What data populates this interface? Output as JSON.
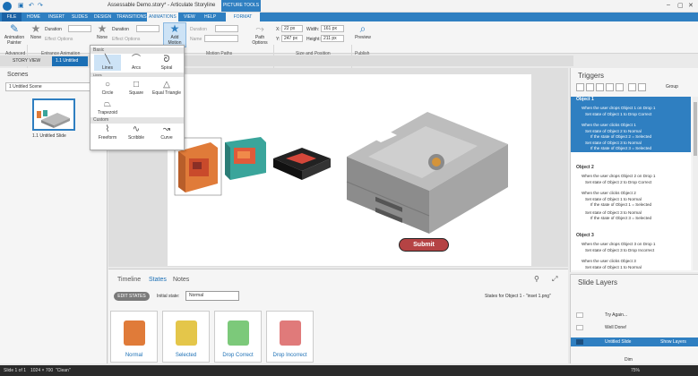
{
  "window": {
    "title": "Assessable Demo.story* - Articulate Storyline",
    "picture_tools": "PICTURE TOOLS"
  },
  "tabs": [
    "FILE",
    "HOME",
    "INSERT",
    "SLIDES",
    "DESIGN",
    "TRANSITIONS",
    "ANIMATIONS",
    "VIEW",
    "HELP",
    "FORMAT"
  ],
  "ribbon": {
    "animation_painter": "Animation Painter",
    "advanced": "Advanced",
    "entrance_none": "None",
    "duration_label": "Duration",
    "effect_options": "Effect Options",
    "entrance_group": "Entrance Animation",
    "exit_none": "None",
    "exit_group": "Exit Animation",
    "add_motion_path": "Add Motion Path",
    "duration2": "Duration",
    "name_label": "Name",
    "path_options": "Path Options",
    "motion_group": "Motion Paths",
    "x_label": "X:",
    "x_value": "22 px",
    "y_label": "Y:",
    "y_value": "247 px",
    "width_label": "Width:",
    "width_value": "161 px",
    "height_label": "Height:",
    "height_value": "211 px",
    "size_group": "Size and Position",
    "preview": "Preview",
    "publish": "Publish"
  },
  "view_tabs": {
    "story_view": "STORY VIEW",
    "slide_tab": "1.1 Untitled Sli..."
  },
  "scenes": {
    "title": "Scenes",
    "selected": "1 Untitled Scene",
    "thumb_label": "1.1 Untitled Slide"
  },
  "shapes": {
    "basic": "Basic",
    "lines_tooltip": "Lines",
    "custom": "Custom",
    "items": [
      "Lines",
      "Arcs",
      "Spiral",
      "Circle",
      "Square",
      "Equal Triangle",
      "Trapezoid",
      "Freeform",
      "Scribble",
      "Curve"
    ]
  },
  "submit": "Submit",
  "bottom": {
    "tabs": [
      "Timeline",
      "States",
      "Notes"
    ],
    "edit_states": "EDIT STATES",
    "initial_state_label": "Initial state:",
    "initial_state": "Normal",
    "states_for": "States for Object 1 - \"inset 1.png\"",
    "states": [
      "Normal",
      "Selected",
      "Drop Correct",
      "Drop Incorrect"
    ]
  },
  "triggers": {
    "title": "Triggers",
    "group": "Group",
    "objects": [
      {
        "name": "Object 1",
        "lines": [
          "When the user drops Object 1 on Drop 1",
          "Set state of Object 1 to Drop Correct",
          "When the user clicks Object 1",
          "Set state of Object 2 to Normal",
          "If the state of Object 2 = Selected",
          "Set state of Object 3 to Normal",
          "If the state of Object 3 = Selected"
        ]
      },
      {
        "name": "Object 2",
        "lines": [
          "When the user drops Object 2 on Drop 1",
          "Set state of Object 2 to Drop Correct",
          "When the user clicks Object 2",
          "Set state of Object 1 to Normal",
          "If the state of Object 1 = Selected",
          "Set state of Object 3 to Normal",
          "If the state of Object 3 = Selected"
        ]
      },
      {
        "name": "Object 3",
        "lines": [
          "When the user drops Object 3 on Drop 1",
          "Set state of Object 3 to Drop Incorrect",
          "When the user clicks Object 3",
          "Set state of Object 1 to Normal"
        ]
      }
    ]
  },
  "layers": {
    "title": "Slide Layers",
    "items": [
      "Try Again...",
      "Well Done!"
    ],
    "base": "Untitled Slide",
    "show_layers": "Show Layers",
    "dim": "Dim"
  },
  "status": {
    "slide": "Slide 1 of 1",
    "size": "1024 × 700",
    "state": "\"Clean\"",
    "zoom": "75%"
  },
  "colors": {
    "accent": "#2f7fc1",
    "submit": "#b54344"
  }
}
